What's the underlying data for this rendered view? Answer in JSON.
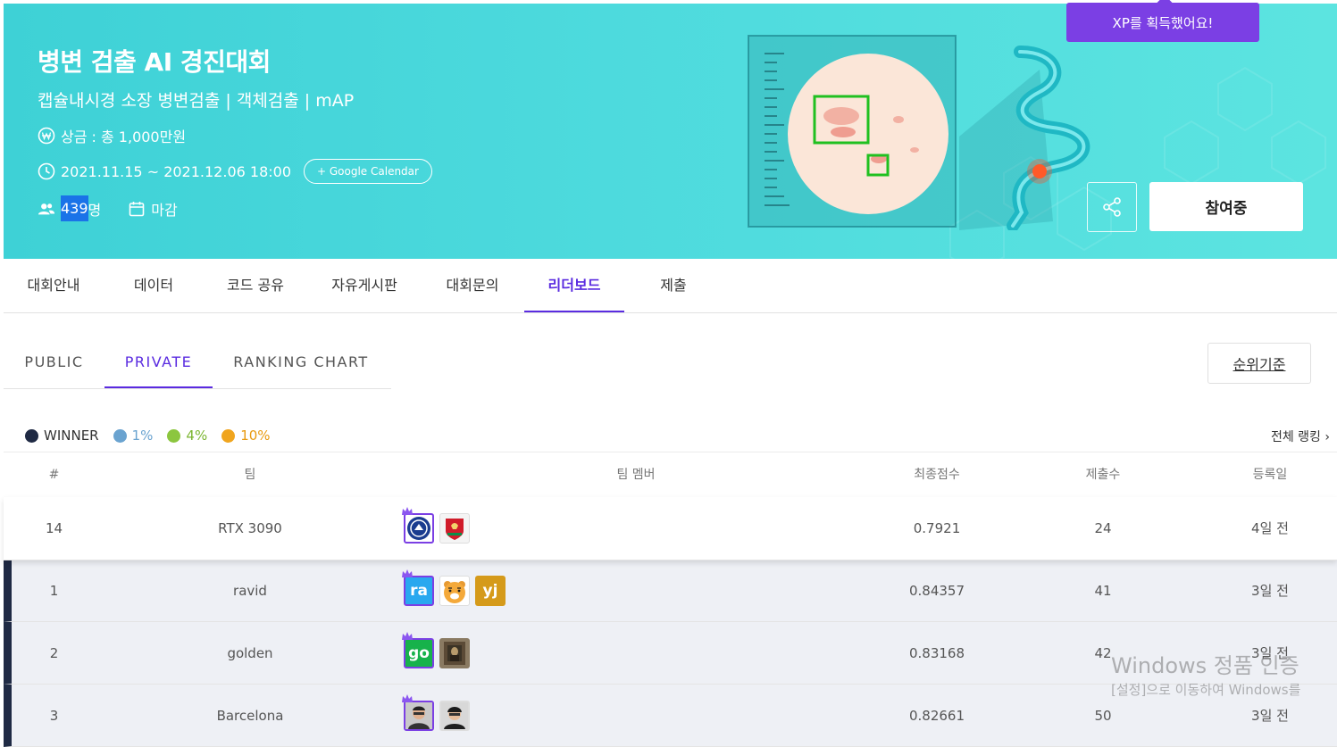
{
  "banner": {
    "title": "병변 검출 AI 경진대회",
    "subtitle": "캡슐내시경 소장 병변검출 | 객체검출 | mAP",
    "prize": "상금 : 총 1,000만원",
    "period": "2021.11.15 ~ 2021.12.06 18:00",
    "gcal_label": "+ Google Calendar",
    "participants_num": "439",
    "participants_unit": "명",
    "status": "마감",
    "join_label": "참여중",
    "bg_color": "#4ddadd"
  },
  "toast": {
    "text": "XP를 획득했어요!"
  },
  "tabs": [
    {
      "label": "대회안내"
    },
    {
      "label": "데이터"
    },
    {
      "label": "코드 공유"
    },
    {
      "label": "자유게시판"
    },
    {
      "label": "대회문의"
    },
    {
      "label": "리더보드"
    },
    {
      "label": "제출"
    }
  ],
  "subtabs": [
    {
      "label": "PUBLIC"
    },
    {
      "label": "PRIVATE"
    },
    {
      "label": "RANKING CHART"
    }
  ],
  "rank_basis": "순위기준",
  "legend": [
    {
      "label": "WINNER",
      "color": "#1f2a44"
    },
    {
      "label": "1%",
      "color": "#6aa3d0"
    },
    {
      "label": "4%",
      "color": "#8cc63f"
    },
    {
      "label": "10%",
      "color": "#f0a51e"
    }
  ],
  "full_ranking": "전체 랭킹",
  "table": {
    "headers": {
      "rank": "#",
      "team": "팀",
      "members": "팀 멤버",
      "score": "최종점수",
      "submits": "제출수",
      "date": "등록일"
    },
    "rows": [
      {
        "rank": "14",
        "team": "RTX 3090",
        "score": "0.7921",
        "submits": "24",
        "date": "4일 전"
      },
      {
        "rank": "1",
        "team": "ravid",
        "score": "0.84357",
        "submits": "41",
        "date": "3일 전"
      },
      {
        "rank": "2",
        "team": "golden",
        "score": "0.83168",
        "submits": "42",
        "date": "3일 전"
      },
      {
        "rank": "3",
        "team": "Barcelona",
        "score": "0.82661",
        "submits": "50",
        "date": "3일 전"
      }
    ],
    "avatars": {
      "ravid_1": "ra",
      "ravid_3": "yj",
      "golden_1": "go"
    }
  },
  "watermark": {
    "line1": "Windows 정품 인증",
    "line2": "[설정]으로 이동하여 Windows를"
  }
}
